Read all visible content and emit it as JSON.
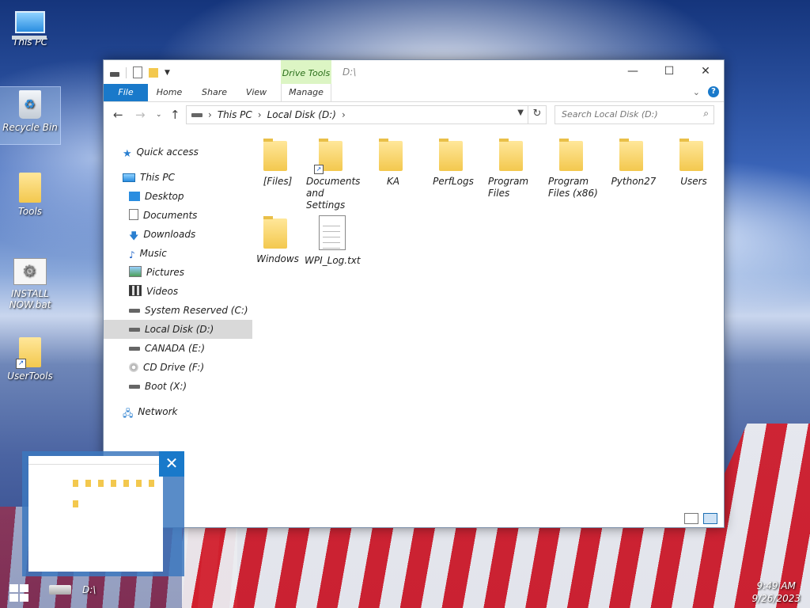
{
  "desktop": {
    "icons": [
      {
        "label": "This PC"
      },
      {
        "label": "Recycle Bin"
      },
      {
        "label": "Tools"
      },
      {
        "label": "INSTALL NOW.bat"
      },
      {
        "label": "UserTools"
      }
    ]
  },
  "window": {
    "contextual_tab": "Drive Tools",
    "title": "D:\\",
    "controls": {
      "minimize": "—",
      "maximize": "☐",
      "close": "✕"
    },
    "ribbon_tabs": [
      "File",
      "Home",
      "Share",
      "View",
      "Manage"
    ],
    "address": {
      "segments": [
        "This PC",
        "Local Disk (D:)"
      ]
    },
    "search": {
      "placeholder": "Search Local Disk (D:)"
    }
  },
  "navpane": {
    "items": [
      {
        "label": "Quick access",
        "icon": "star-icon"
      },
      {
        "label": "This PC",
        "icon": "computer-icon"
      },
      {
        "label": "Desktop",
        "icon": "desktop-icon"
      },
      {
        "label": "Documents",
        "icon": "documents-icon"
      },
      {
        "label": "Downloads",
        "icon": "downloads-icon"
      },
      {
        "label": "Music",
        "icon": "music-icon"
      },
      {
        "label": "Pictures",
        "icon": "pictures-icon"
      },
      {
        "label": "Videos",
        "icon": "videos-icon"
      },
      {
        "label": "System Reserved (C:)",
        "icon": "drive-icon"
      },
      {
        "label": "Local Disk (D:)",
        "icon": "drive-icon",
        "selected": true
      },
      {
        "label": "CANADA (E:)",
        "icon": "drive-icon"
      },
      {
        "label": "CD Drive (F:)",
        "icon": "cd-drive-icon"
      },
      {
        "label": "Boot (X:)",
        "icon": "drive-icon"
      },
      {
        "label": "Network",
        "icon": "network-icon"
      }
    ]
  },
  "content": {
    "items": [
      {
        "label": "[Files]",
        "type": "folder"
      },
      {
        "label": "Documents and Settings",
        "type": "folder-shortcut"
      },
      {
        "label": "KA",
        "type": "folder"
      },
      {
        "label": "PerfLogs",
        "type": "folder"
      },
      {
        "label": "Program Files",
        "type": "folder"
      },
      {
        "label": "Program Files (x86)",
        "type": "folder"
      },
      {
        "label": "Python27",
        "type": "folder"
      },
      {
        "label": "Users",
        "type": "folder"
      },
      {
        "label": "Windows",
        "type": "folder"
      },
      {
        "label": "WPI_Log.txt",
        "type": "text-file"
      }
    ]
  },
  "taskbar": {
    "app_label": "D:\\",
    "time": "9:49 AM",
    "date": "9/26/2023"
  },
  "colors": {
    "accent": "#1979ca",
    "contextual_tab_bg": "#dcf5c4",
    "folder": "#f3c84e"
  }
}
